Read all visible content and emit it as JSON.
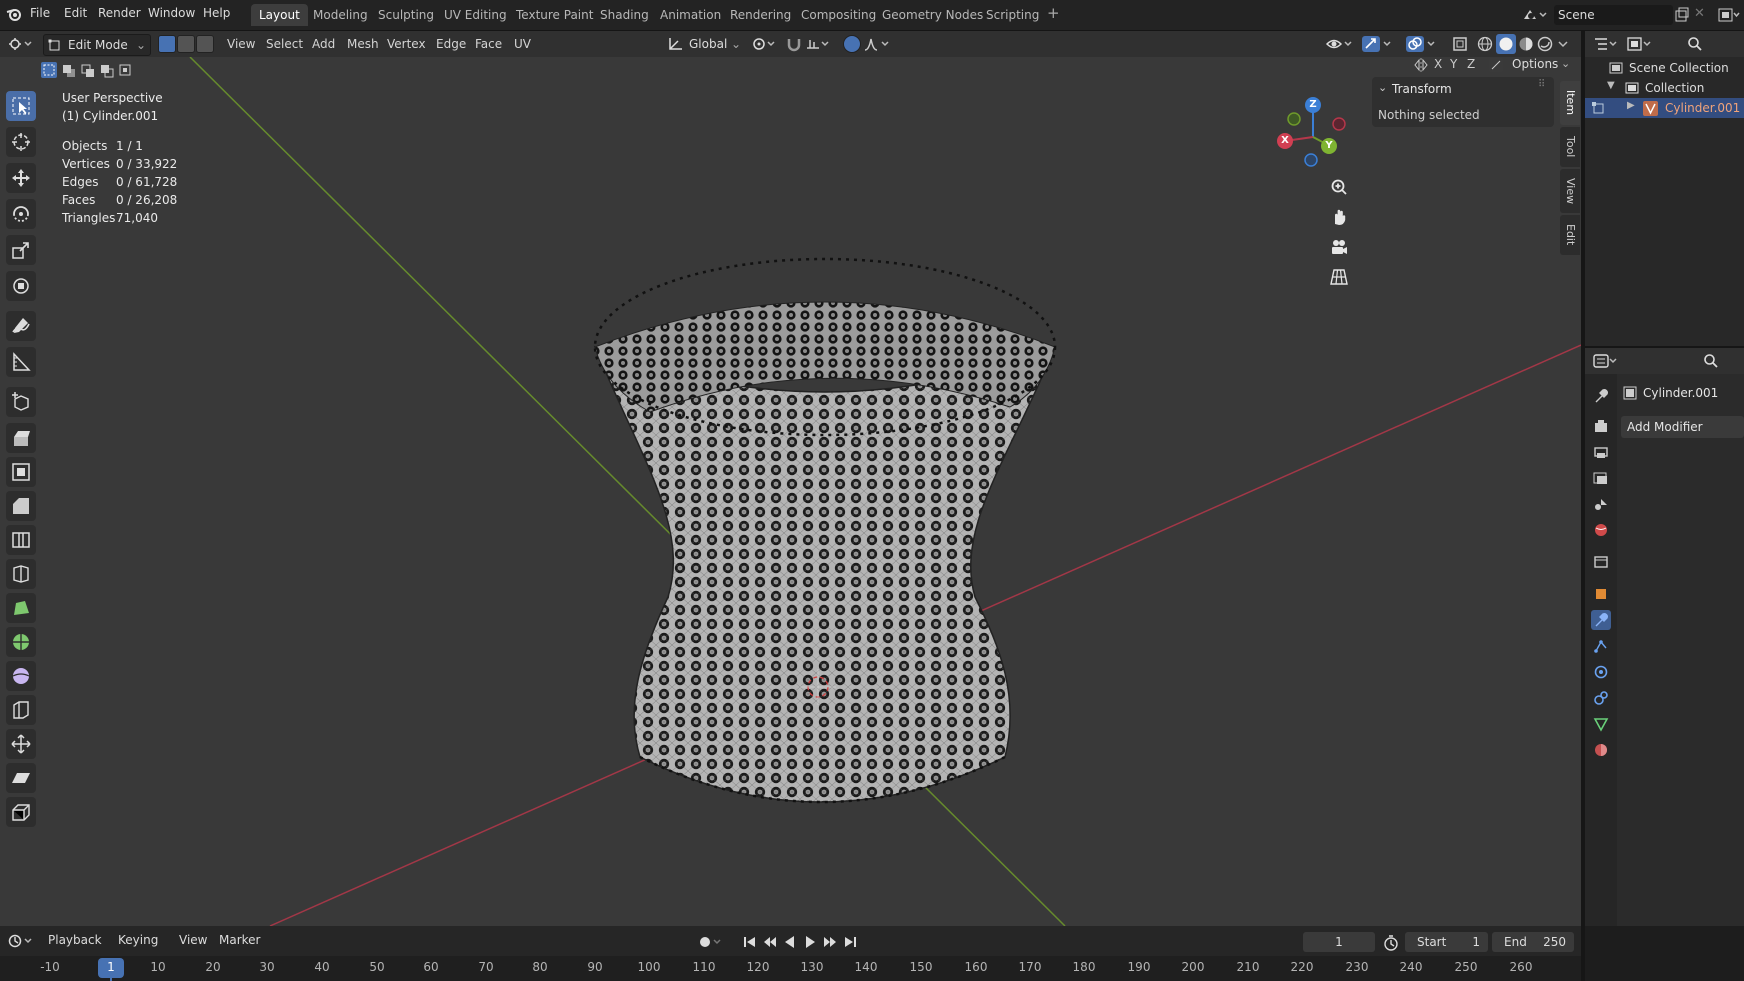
{
  "topbar": {
    "menu": [
      "File",
      "Edit",
      "Render",
      "Window",
      "Help"
    ],
    "workspaces": [
      "Layout",
      "Modeling",
      "Sculpting",
      "UV Editing",
      "Texture Paint",
      "Shading",
      "Animation",
      "Rendering",
      "Compositing",
      "Geometry Nodes",
      "Scripting"
    ],
    "add_workspace": "+",
    "scene": "Scene"
  },
  "viewport_header": {
    "mode": "Edit Mode",
    "menus": [
      "View",
      "Select",
      "Add",
      "Mesh",
      "Vertex",
      "Edge",
      "Face",
      "UV"
    ],
    "orientation": "Global",
    "options": "Options",
    "axes": [
      "X",
      "Y",
      "Z"
    ]
  },
  "overlay": {
    "perspective": "User Perspective",
    "object": "(1) Cylinder.001",
    "stats": [
      {
        "label": "Objects",
        "value": "1 / 1"
      },
      {
        "label": "Vertices",
        "value": "0 / 33,922"
      },
      {
        "label": "Edges",
        "value": "0 / 61,728"
      },
      {
        "label": "Faces",
        "value": "0 / 26,208"
      },
      {
        "label": "Triangles",
        "value": "71,040"
      }
    ]
  },
  "sidebar_panel": {
    "title": "Transform",
    "message": "Nothing selected",
    "tabs": [
      "Item",
      "Tool",
      "View",
      "Edit"
    ]
  },
  "gizmo": {
    "x": "X",
    "y": "Y",
    "z": "Z"
  },
  "outliner": {
    "root": "Scene Collection",
    "collection": "Collection",
    "object": "Cylinder.001"
  },
  "properties": {
    "object": "Cylinder.001",
    "add_modifier": "Add Modifier"
  },
  "timeline": {
    "menus": [
      "Playback",
      "Keying",
      "View",
      "Marker"
    ],
    "current_frame": "1",
    "start_label": "Start",
    "start": "1",
    "end_label": "End",
    "end": "250",
    "ticks": [
      "-10",
      "1",
      "10",
      "20",
      "30",
      "40",
      "50",
      "60",
      "70",
      "80",
      "90",
      "100",
      "110",
      "120",
      "130",
      "140",
      "150",
      "160",
      "170",
      "180",
      "190",
      "200",
      "210",
      "220",
      "230",
      "240",
      "250",
      "260"
    ]
  },
  "colors": {
    "accent": "#4772b3",
    "x_axis": "#b5374a",
    "y_axis": "#6f9a2b",
    "z_axis": "#3b7fd6"
  }
}
